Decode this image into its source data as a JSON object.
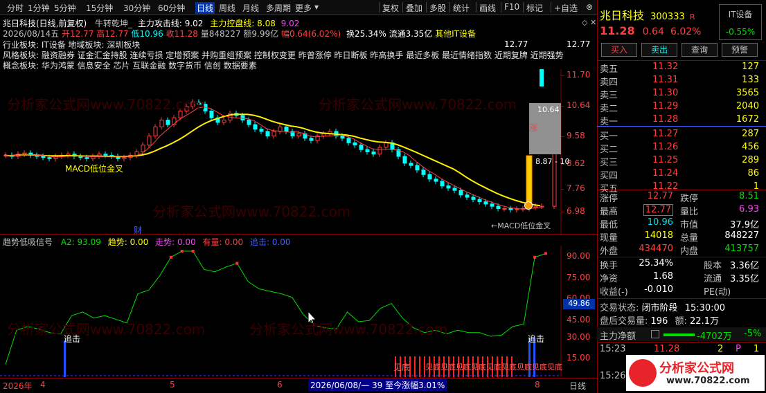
{
  "toolbar": {
    "left": [
      "分时",
      "1分钟",
      "5分钟",
      "15分钟",
      "30分钟",
      "60分钟",
      "日线",
      "周线",
      "月线",
      "多周期",
      "更多"
    ],
    "active_index": 6,
    "right": [
      "复权",
      "叠加",
      "多股",
      "统计",
      "画线",
      "F10",
      "标记",
      "+自选"
    ]
  },
  "chart_header": {
    "title": "兆日科技(日线,前复权)",
    "indicator_name": "牛转乾坤_",
    "indicator_text": "主力攻击线: 9.02",
    "indicator_text2": "主力控盘线: 8.08",
    "indicator_text3": "9.02",
    "date": "2026/08/14五",
    "open": "开12.77",
    "high": "高12.77",
    "low": "低10.96",
    "close": "收11.28",
    "volume": "量848227",
    "amount": "额9.99亿",
    "change": "幅0.64(6.02%)",
    "turnover": "换25.34%",
    "float": "流通3.35亿",
    "other": "其他IT设备"
  },
  "sectors": {
    "industry": "行业板块: IT设备 地域板块: 深圳板块",
    "style": "风格板块: 融资融券 证金汇金持股 连续亏损 定增预案 并购重组预案 控制权变更 昨曾涨停 昨日断板 昨高换手 最近多板 最近情绪指数 近期复牌 近期强势",
    "concept": "概念板块: 华为鸿蒙 信息安全 芯片 互联金融 数字货币 信创 数据要素"
  },
  "annotations": {
    "macd": "MACD低位金叉",
    "cai": "财",
    "high_price": "12.77",
    "gray_box_price": "10.64",
    "range_text": "8.87 - 10",
    "rise": "涨",
    "macd_bottom": "←MACD低位金叉",
    "low_price": "6.96"
  },
  "price_axis": [
    "12.77",
    "11.70",
    "10.64",
    "9.58",
    "8.62",
    "7.76",
    "6.98"
  ],
  "lower_header": {
    "name": "趋势低吸信号",
    "a2": "A2: 93.09",
    "trend": "趋势: 0.00",
    "move": "走势: 0.00",
    "have": "有量: 0.00",
    "chase": "追击: 0.00"
  },
  "lower_axis": [
    "90.00",
    "75.00",
    "60.00",
    "45.00",
    "30.00",
    "15.00"
  ],
  "lower_cursor_value": "49.86",
  "lower_labels": {
    "chase1": "追击",
    "chase2": "追击",
    "see_bottom": "见底",
    "see_bottom_multi": "见底见底见底见底见底见底见底见底见底"
  },
  "bottom_axis": {
    "year": "2026年",
    "m4": "4",
    "m5": "5",
    "m6": "6",
    "m8": "8",
    "status": "2026/06/08/— 39 至今涨幅3.01%",
    "period": "日线"
  },
  "chart_data": {
    "type": "line",
    "series": [
      {
        "name": "A2",
        "values": [
          2,
          30,
          33,
          31,
          28,
          27,
          42,
          45,
          40,
          42,
          39,
          36,
          60,
          63,
          75,
          90,
          95,
          95,
          80,
          78,
          82,
          85,
          70,
          64,
          62,
          60,
          57,
          43,
          34,
          32,
          31,
          45,
          37,
          38,
          48,
          52,
          40,
          32,
          28,
          30,
          27,
          30,
          28,
          28,
          25,
          26,
          33,
          35,
          90,
          93.09
        ]
      }
    ],
    "ylim": [
      0,
      95
    ]
  },
  "quote": {
    "name": "兆日科技",
    "code": "300333",
    "flag": "R",
    "sector": "IT设备",
    "sector_change": "-0.55%",
    "price": "11.28",
    "change": "0.64",
    "pct": "6.02%",
    "buttons": [
      "买入",
      "卖出",
      "查询",
      "预警"
    ],
    "asks": [
      {
        "label": "卖五",
        "price": "11.32",
        "vol": "127"
      },
      {
        "label": "卖四",
        "price": "11.31",
        "vol": "133"
      },
      {
        "label": "卖三",
        "price": "11.30",
        "vol": "3565"
      },
      {
        "label": "卖二",
        "price": "11.29",
        "vol": "2040"
      },
      {
        "label": "卖一",
        "price": "11.28",
        "vol": "1672"
      }
    ],
    "bids": [
      {
        "label": "买一",
        "price": "11.27",
        "vol": "287"
      },
      {
        "label": "买二",
        "price": "11.26",
        "vol": "456"
      },
      {
        "label": "买三",
        "price": "11.25",
        "vol": "289"
      },
      {
        "label": "买四",
        "price": "11.24",
        "vol": "86"
      },
      {
        "label": "买五",
        "price": "11.22",
        "vol": "1"
      }
    ],
    "stats": [
      {
        "l1": "涨停",
        "v1": "12.77",
        "l2": "跌停",
        "v2": "8.51"
      },
      {
        "l1": "最高",
        "v1": "12.77",
        "l2": "量比",
        "v2": "6.93"
      },
      {
        "l1": "最低",
        "v1": "10.96",
        "l2": "市值",
        "v2": "37.9亿"
      },
      {
        "l1": "现量",
        "v1": "14018",
        "l2": "总量",
        "v2": "848227"
      },
      {
        "l1": "外盘",
        "v1": "434470",
        "l2": "内盘",
        "v2": "413757"
      }
    ],
    "fin": [
      {
        "l1": "换手",
        "v1": "25.34%",
        "l2": "股本",
        "v2": "3.36亿"
      },
      {
        "l1": "净资",
        "v1": "1.68",
        "l2": "流通",
        "v2": "3.35亿"
      },
      {
        "l1": "收益(-)",
        "v1": "-0.010",
        "l2": "PE(动)",
        "v2": ""
      }
    ],
    "trade_status_label": "交易状态:",
    "trade_status": "闭市阶段",
    "trade_time": "15:30:00",
    "after_label": "盘后交易量:",
    "after_vol": "196",
    "after_amt_label": "额:",
    "after_amt": "22.1万",
    "main_label": "主力净额",
    "main_val": "-4702万",
    "main_pct": "-5%",
    "ticks": [
      {
        "time": "15:23",
        "price": "11.28",
        "vol": "2",
        "flag": "P",
        "n": "1"
      },
      {
        "time": "15:26",
        "price": "",
        "vol": "",
        "flag": "",
        "n": ""
      }
    ]
  },
  "logo": {
    "text": "分析家公式网",
    "url": "www.70822.com"
  },
  "watermark": "分析家公式网www.70822.com"
}
